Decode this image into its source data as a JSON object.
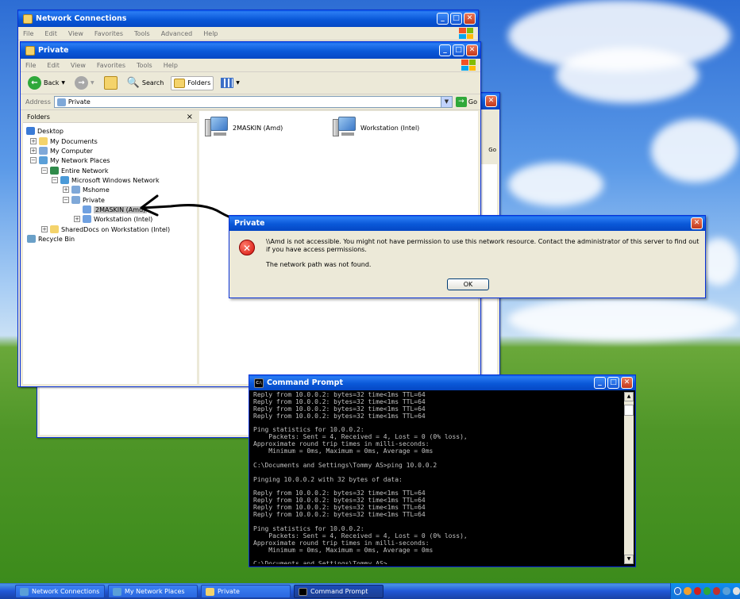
{
  "colors": {
    "titlebar": "#0a58d8",
    "window": "#ece9d8",
    "console_bg": "#000000",
    "console_fg": "#c0c0c0",
    "error": "#d4110a"
  },
  "window_back": {
    "title": "Network Connections",
    "menu": [
      "File",
      "Edit",
      "View",
      "Favorites",
      "Tools",
      "Advanced",
      "Help"
    ],
    "go_label": "Go"
  },
  "explorer": {
    "title": "Private",
    "menu": [
      "File",
      "Edit",
      "View",
      "Favorites",
      "Tools",
      "Help"
    ],
    "toolbar": {
      "back": "Back",
      "search": "Search",
      "folders": "Folders"
    },
    "address_label": "Address",
    "address_value": "Private",
    "go_label": "Go",
    "folders_title": "Folders",
    "folders_close": "×",
    "tree": [
      {
        "label": "Desktop",
        "icon": "desktop-icon",
        "color": "#3b7bd6"
      },
      {
        "label": "My Documents",
        "icon": "folder-icon",
        "color": "#f4d36b"
      },
      {
        "label": "My Computer",
        "icon": "computer-icon",
        "color": "#7fa8d8"
      },
      {
        "label": "My Network Places",
        "icon": "network-places-icon",
        "color": "#5a9fd8"
      },
      {
        "label": "Entire Network",
        "icon": "globe-icon",
        "color": "#2f8a4a"
      },
      {
        "label": "Microsoft Windows Network",
        "icon": "network-icon",
        "color": "#4a9ad8"
      },
      {
        "label": "Mshome",
        "icon": "workgroup-icon",
        "color": "#7fa8d8"
      },
      {
        "label": "Private",
        "icon": "workgroup-icon",
        "color": "#7fa8d8"
      },
      {
        "label": "2MASKIN (Amd)",
        "icon": "computer-icon",
        "color": "#6fa0e0"
      },
      {
        "label": "Workstation (Intel)",
        "icon": "computer-icon",
        "color": "#6fa0e0"
      },
      {
        "label": "SharedDocs on Workstation (Intel)",
        "icon": "shared-folder-icon",
        "color": "#f4d36b"
      },
      {
        "label": "Recycle Bin",
        "icon": "recycle-bin-icon",
        "color": "#6aa0c8"
      }
    ],
    "items": [
      {
        "label": "2MASKIN (Amd)"
      },
      {
        "label": "Workstation (Intel)"
      }
    ]
  },
  "dialog": {
    "title": "Private",
    "message": "\\\\Amd is not accessible. You might not have permission to use this network resource. Contact the administrator of this server to find out if you have access permissions.",
    "detail": "The network path was not found.",
    "ok": "OK"
  },
  "cmd": {
    "title": "Command Prompt",
    "icon_text": "C:\\",
    "lines": [
      "Reply from 10.0.0.2: bytes=32 time<1ms TTL=64",
      "Reply from 10.0.0.2: bytes=32 time<1ms TTL=64",
      "Reply from 10.0.0.2: bytes=32 time<1ms TTL=64",
      "Reply from 10.0.0.2: bytes=32 time<1ms TTL=64",
      "",
      "Ping statistics for 10.0.0.2:",
      "    Packets: Sent = 4, Received = 4, Lost = 0 (0% loss),",
      "Approximate round trip times in milli-seconds:",
      "    Minimum = 0ms, Maximum = 0ms, Average = 0ms",
      "",
      "C:\\Documents and Settings\\Tommy AS>ping 10.0.0.2",
      "",
      "Pinging 10.0.0.2 with 32 bytes of data:",
      "",
      "Reply from 10.0.0.2: bytes=32 time<1ms TTL=64",
      "Reply from 10.0.0.2: bytes=32 time<1ms TTL=64",
      "Reply from 10.0.0.2: bytes=32 time<1ms TTL=64",
      "Reply from 10.0.0.2: bytes=32 time<1ms TTL=64",
      "",
      "Ping statistics for 10.0.0.2:",
      "    Packets: Sent = 4, Received = 4, Lost = 0 (0% loss),",
      "Approximate round trip times in milli-seconds:",
      "    Minimum = 0ms, Maximum = 0ms, Average = 0ms",
      "",
      "C:\\Documents and Settings\\Tommy AS>"
    ]
  },
  "taskbar": {
    "tasks": [
      {
        "label": "Network Connections",
        "icon": "network-connections-icon"
      },
      {
        "label": "My Network Places",
        "icon": "network-places-icon"
      },
      {
        "label": "Private",
        "icon": "folder-icon"
      },
      {
        "label": "Command Prompt",
        "icon": "command-prompt-icon"
      }
    ]
  }
}
